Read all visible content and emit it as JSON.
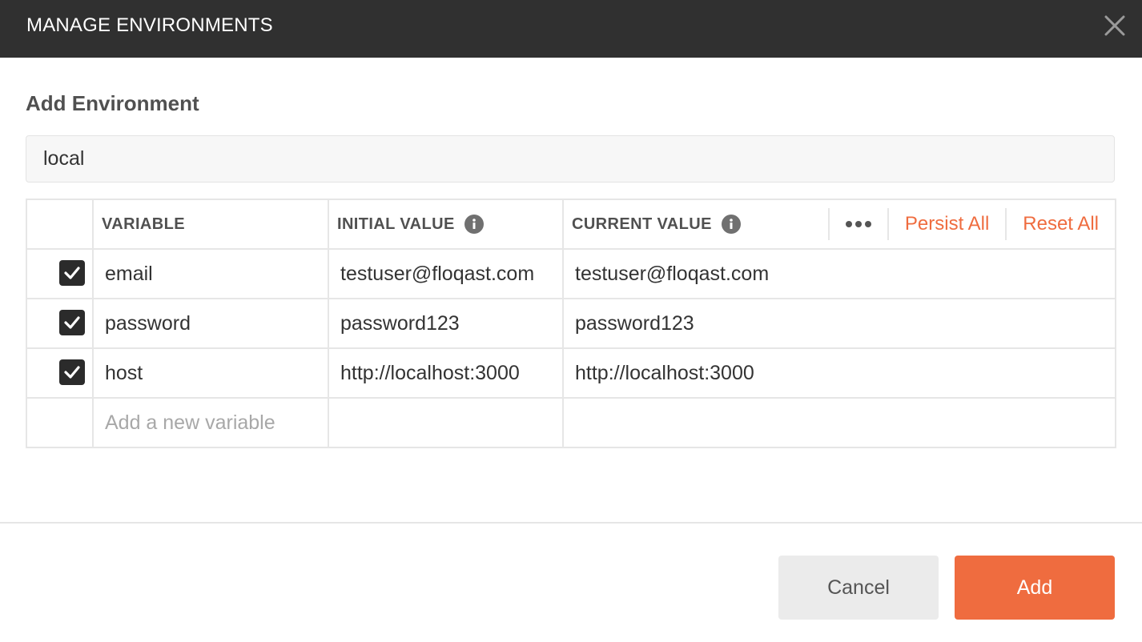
{
  "window": {
    "title": "MANAGE ENVIRONMENTS",
    "close_icon": "close-icon"
  },
  "form": {
    "heading": "Add Environment",
    "environment_name": "local"
  },
  "table": {
    "columns": {
      "variable": "VARIABLE",
      "initial_value": "INITIAL VALUE",
      "current_value": "CURRENT VALUE"
    },
    "actions": {
      "more_icon": "more-horizontal-icon",
      "persist_all": "Persist All",
      "reset_all": "Reset All"
    },
    "rows": [
      {
        "enabled": true,
        "variable": "email",
        "initial_value": "testuser@floqast.com",
        "current_value": "testuser@floqast.com"
      },
      {
        "enabled": true,
        "variable": "password",
        "initial_value": "password123",
        "current_value": "password123"
      },
      {
        "enabled": true,
        "variable": "host",
        "initial_value": "http://localhost:3000",
        "current_value": "http://localhost:3000"
      }
    ],
    "new_row_placeholder": "Add a new variable"
  },
  "footer": {
    "cancel_label": "Cancel",
    "add_label": "Add"
  },
  "colors": {
    "title_bar": "#303030",
    "accent": "#ef6c3f",
    "checkbox": "#2b2b2b",
    "cancel_bg": "#ebebeb"
  }
}
